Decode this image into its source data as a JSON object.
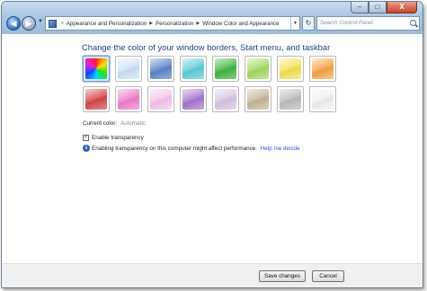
{
  "window": {
    "minimize_label": "–",
    "maximize_label": "□",
    "close_label": "X"
  },
  "nav": {
    "back_glyph": "◀",
    "forward_glyph": "▶",
    "dropdown_glyph": "▼"
  },
  "address": {
    "prefix": "«",
    "separator": "▶",
    "crumbs": [
      "Appearance and Personalization",
      "Personalization",
      "Window Color and Appearance"
    ],
    "dropdown_glyph": "▼",
    "refresh_glyph": "↻"
  },
  "search": {
    "placeholder": "Search Control Panel"
  },
  "main": {
    "title": "Change the color of your window borders, Start menu, and taskbar",
    "swatches": [
      {
        "name": "rainbow",
        "color": "rainbow",
        "selected": true
      },
      {
        "name": "sky",
        "color": "#cfe3f8"
      },
      {
        "name": "twilight",
        "color": "#5e86c8"
      },
      {
        "name": "sea",
        "color": "#5fcfda"
      },
      {
        "name": "leaf",
        "color": "#45b645"
      },
      {
        "name": "lime",
        "color": "#a7dc62"
      },
      {
        "name": "lemon",
        "color": "#f6e25a"
      },
      {
        "name": "pumpkin",
        "color": "#f7a64a"
      },
      {
        "name": "ruby",
        "color": "#d74a4a"
      },
      {
        "name": "fuchsia",
        "color": "#f07ecb"
      },
      {
        "name": "blush",
        "color": "#f6c4ec"
      },
      {
        "name": "violet",
        "color": "#a77ad2"
      },
      {
        "name": "lavender",
        "color": "#d8c6e6"
      },
      {
        "name": "taupe",
        "color": "#c8b99a"
      },
      {
        "name": "chocolate",
        "color": "#bfbfbf"
      },
      {
        "name": "frost",
        "color": "#f2f2f2"
      }
    ],
    "current_color_label": "Current color:",
    "current_color_value": "Automatic",
    "transparency_label": "Enable transparency",
    "transparency_checked": true,
    "check_glyph": "✓",
    "info_glyph": "i",
    "info_text": "Enabling transparency on this computer might affect performance.",
    "help_link": "Help me decide"
  },
  "footer": {
    "save_label": "Save changes",
    "cancel_label": "Cancel"
  }
}
